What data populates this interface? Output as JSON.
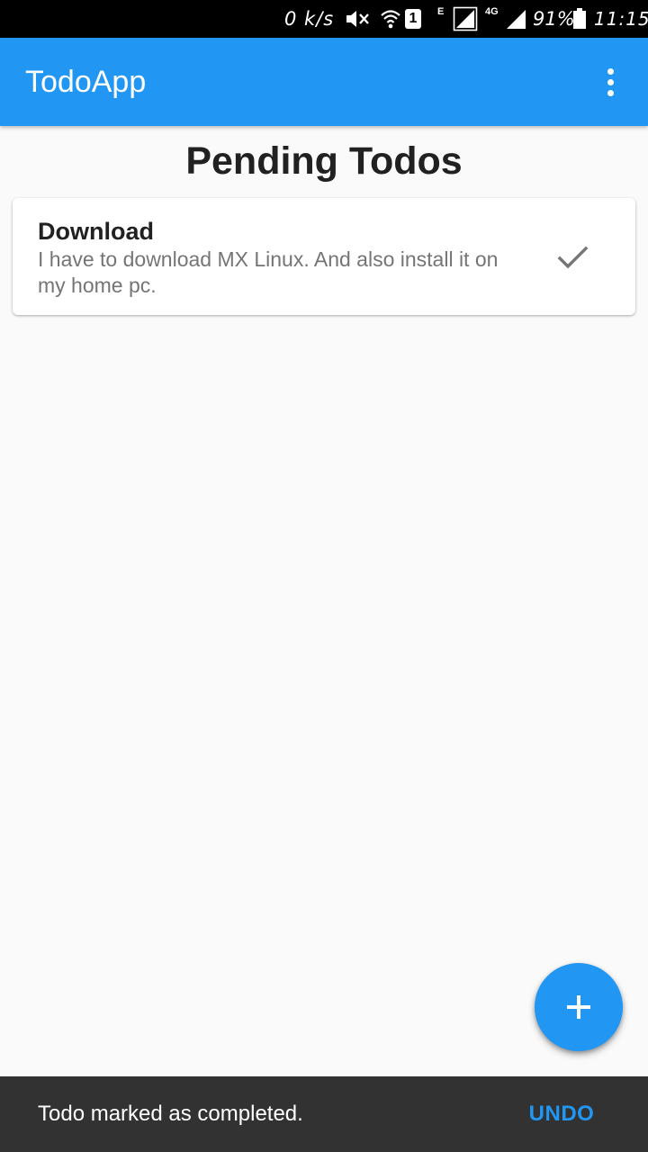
{
  "status_bar": {
    "net_speed": "0 k/s",
    "sim_slot": "1",
    "network_type_1": "E",
    "network_type_2": "4G",
    "battery": "91%",
    "time": "11:15",
    "icons": [
      "mute-icon",
      "wifi-icon",
      "signal-icon",
      "signal-icon",
      "battery-icon"
    ]
  },
  "app_bar": {
    "title": "TodoApp",
    "menu_icon": "more-vert-icon",
    "color": "#2196f3"
  },
  "main": {
    "heading": "Pending Todos",
    "todos": [
      {
        "title": "Download",
        "description": "I have to download MX Linux. And also install it on my home pc.",
        "action_icon": "check-icon"
      }
    ]
  },
  "fab": {
    "icon": "add-icon",
    "color": "#2196f3"
  },
  "snackbar": {
    "message": "Todo marked as completed.",
    "action_label": "UNDO",
    "action_color": "#2196f3"
  }
}
